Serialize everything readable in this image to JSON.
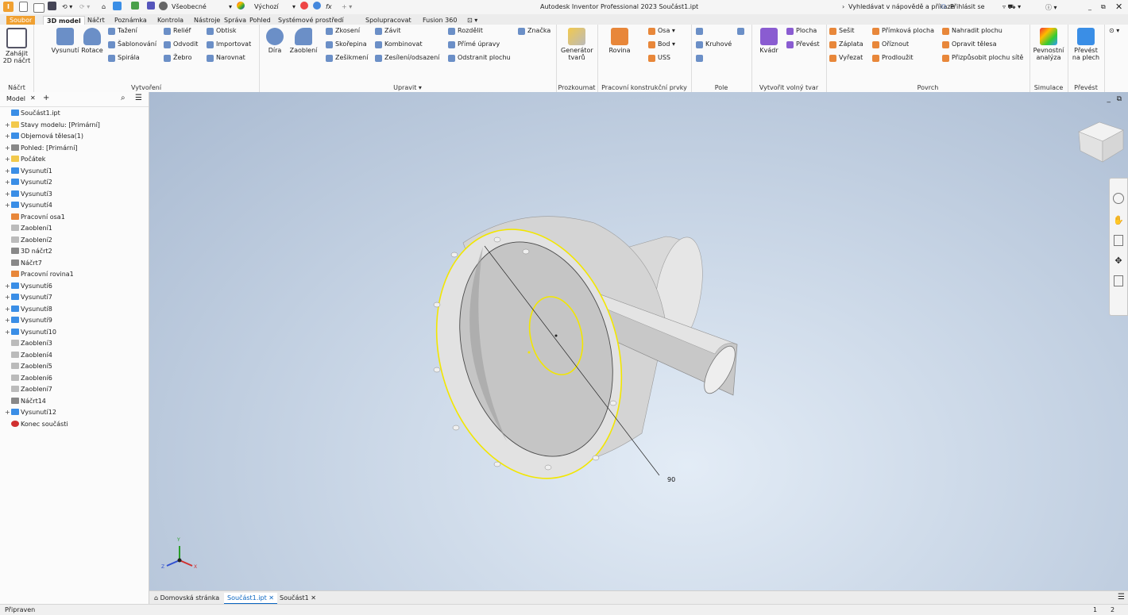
{
  "app": {
    "title": "Autodesk Inventor Professional 2023  Součást1.ipt",
    "search_label": "Vyhledávat v nápovědě a příkaze",
    "signin_label": "Přihlásit se",
    "material_value": "Všeobecné",
    "appearance_value": "Výchozí"
  },
  "tabs": [
    "Soubor",
    "3D model",
    "Náčrt",
    "Poznámka",
    "Kontrola",
    "Nástroje",
    "Správa",
    "Pohled",
    "Systémové prostředí",
    "Spolupracovat",
    "Fusion 360"
  ],
  "ribbon": {
    "groups": {
      "sketch": "Náčrt",
      "create": "Vytvoření",
      "modify": "Upravit ▾",
      "explore": "Prozkoumat",
      "work": "Pracovní konstrukční prvky",
      "pattern": "Pole",
      "freeform": "Vytvořit volný tvar",
      "surface": "Povrch",
      "simulation": "Simulace",
      "convert": "Převést"
    },
    "sketch_btn": "Zahájit 2D náčrt",
    "extrude": "Vysunutí",
    "revolve": "Rotace",
    "create_small": [
      "Tažení",
      "Šablonování",
      "Spirála",
      "Reliéf",
      "Odvodit",
      "Žebro",
      "Obtisk",
      "Importovat",
      "Narovnat"
    ],
    "hole": "Díra",
    "fillet": "Zaoblení",
    "modify_small": [
      "Zkosení",
      "Skořepina",
      "Zešikmení",
      "Závit",
      "Kombinovat",
      "Zesílení/odsazení",
      "Rozdělit",
      "Přímé úpravy",
      "Odstranit plochu",
      "Značka"
    ],
    "shape_gen": "Generátor tvarů",
    "plane": "Rovina",
    "work_small": [
      "Osa ▾",
      "Bod ▾",
      "USS"
    ],
    "pattern_small": [
      "Kruhové"
    ],
    "box": "Kvádr",
    "freeform_small": [
      "Plocha",
      "Převést"
    ],
    "surface_small": [
      "Sešit",
      "Záplata",
      "Vyřezat",
      "Přímková plocha",
      "Oříznout",
      "Prodloužit",
      "Nahradit plochu",
      "Opravit tělesa",
      "Přizpůsobit plochu sítě"
    ],
    "stress": "Pevnostní analýza",
    "sheet": "Převést na plech"
  },
  "browser": {
    "tab_label": "Model",
    "items": [
      {
        "label": "Součást1.ipt",
        "plus": "",
        "icon": "part-icon"
      },
      {
        "label": "Stavy modelu: [Primární]",
        "plus": "+",
        "icon": "folder-icon"
      },
      {
        "label": "Objemová tělesa(1)",
        "plus": "+",
        "icon": "solid-icon"
      },
      {
        "label": "Pohled: [Primární]",
        "plus": "+",
        "icon": "view-icon"
      },
      {
        "label": "Počátek",
        "plus": "+",
        "icon": "folder-icon"
      },
      {
        "label": "Vysunutí1",
        "plus": "+",
        "icon": "extrude-icon"
      },
      {
        "label": "Vysunutí2",
        "plus": "+",
        "icon": "extrude-icon"
      },
      {
        "label": "Vysunutí3",
        "plus": "+",
        "icon": "extrude-icon"
      },
      {
        "label": "Vysunutí4",
        "plus": "+",
        "icon": "extrude-icon"
      },
      {
        "label": "Pracovní osa1",
        "plus": "",
        "icon": "axis-icon"
      },
      {
        "label": "Zaoblení1",
        "plus": "",
        "icon": "fillet-icon"
      },
      {
        "label": "Zaoblení2",
        "plus": "",
        "icon": "fillet-icon"
      },
      {
        "label": "3D náčrt2",
        "plus": "",
        "icon": "sketch3d-icon"
      },
      {
        "label": "Náčrt7",
        "plus": "",
        "icon": "sketch-icon"
      },
      {
        "label": "Pracovní rovina1",
        "plus": "",
        "icon": "plane-icon"
      },
      {
        "label": "Vysunutí6",
        "plus": "+",
        "icon": "extrude-icon"
      },
      {
        "label": "Vysunutí7",
        "plus": "+",
        "icon": "extrude-icon"
      },
      {
        "label": "Vysunutí8",
        "plus": "+",
        "icon": "extrude-icon"
      },
      {
        "label": "Vysunutí9",
        "plus": "+",
        "icon": "extrude-icon"
      },
      {
        "label": "Vysunutí10",
        "plus": "+",
        "icon": "extrude-icon"
      },
      {
        "label": "Zaoblení3",
        "plus": "",
        "icon": "fillet-icon"
      },
      {
        "label": "Zaoblení4",
        "plus": "",
        "icon": "fillet-icon"
      },
      {
        "label": "Zaoblení5",
        "plus": "",
        "icon": "fillet-icon"
      },
      {
        "label": "Zaoblení6",
        "plus": "",
        "icon": "fillet-icon"
      },
      {
        "label": "Zaoblení7",
        "plus": "",
        "icon": "fillet-icon"
      },
      {
        "label": "Náčrt14",
        "plus": "",
        "icon": "sketch-icon"
      },
      {
        "label": "Vysunutí12",
        "plus": "+",
        "icon": "extrude-icon"
      },
      {
        "label": "Konec součásti",
        "plus": "",
        "icon": "end-icon"
      }
    ]
  },
  "viewport": {
    "dimension_label": "90",
    "triad_x": "X",
    "triad_y": "Y",
    "triad_z": "Z"
  },
  "doc_tabs": {
    "home": "Domovská stránka",
    "tab1": "Součást1.ipt",
    "tab2": "Součást1"
  },
  "status": {
    "text": "Připraven",
    "n1": "1",
    "n2": "2"
  },
  "colors": {
    "file_tab": "#f0a030",
    "accent": "#0a66c2",
    "highlight": "#f2e600",
    "part": "#cfcfcf"
  }
}
